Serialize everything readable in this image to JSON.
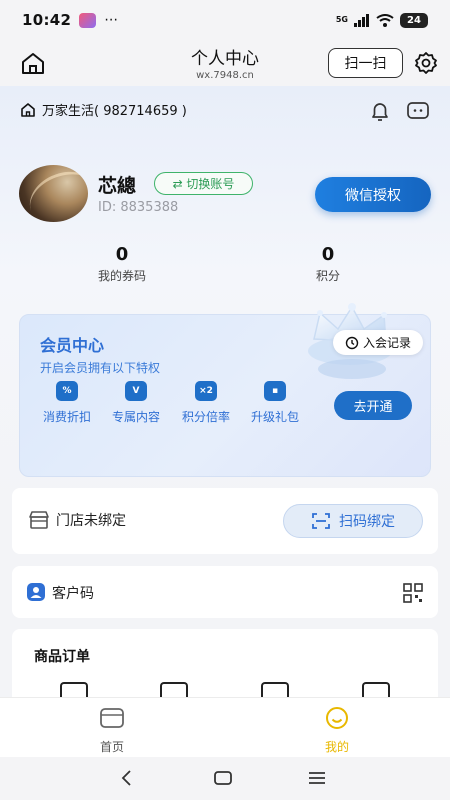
{
  "status_bar": {
    "time": "10:42",
    "more": "⋯",
    "network": "5G",
    "battery": "24"
  },
  "nav": {
    "title": "个人中心",
    "subtitle": "wx.7948.cn",
    "scan_label": "扫一扫",
    "icons": [
      "home-icon",
      "gear-icon"
    ]
  },
  "store": {
    "name": "万家生活( 982714659 )"
  },
  "user": {
    "name": "芯總",
    "switch_label": "⇄ 切换账号",
    "id": "ID: 8835388",
    "wechat_label": "微信授权"
  },
  "stats": [
    {
      "value": "0",
      "label": "我的券码"
    },
    {
      "value": "0",
      "label": "积分"
    }
  ],
  "vip": {
    "title": "会员中心",
    "subtitle": "开启会员拥有以下特权",
    "records_label": "入会记录",
    "open_label": "去开通",
    "perks": [
      {
        "label": "消费折扣",
        "glyph": "%"
      },
      {
        "label": "专属内容",
        "glyph": "V"
      },
      {
        "label": "积分倍率",
        "glyph": "×2"
      },
      {
        "label": "升级礼包",
        "glyph": "▪"
      }
    ]
  },
  "store_binding": {
    "label": "门店未绑定",
    "button_label": "扫码绑定"
  },
  "customer_code": {
    "label": "客户码"
  },
  "orders": {
    "title": "商品订单"
  },
  "tabs": [
    {
      "label": "首页",
      "active": false
    },
    {
      "label": "我的",
      "active": true
    }
  ],
  "colors": {
    "accent": "#1f6fc8",
    "active_tab": "#e8b800",
    "green": "#2d9c56"
  }
}
